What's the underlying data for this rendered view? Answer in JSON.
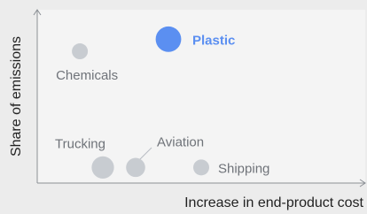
{
  "chart_data": {
    "type": "scatter",
    "xlabel": "Increase in end-product cost",
    "ylabel": "Share of emissions",
    "xlim": [
      0,
      10
    ],
    "ylim": [
      0,
      10
    ],
    "grid": false,
    "colors": {
      "highlight": "#5b8ff1",
      "point": "#c8ccd1",
      "label": "#6f7379",
      "axis": "#8b8f95",
      "background": "#ececec",
      "plot_background": "#f4f4f4"
    },
    "points": [
      {
        "label": "Chemicals",
        "x": 1.3,
        "y": 7.6,
        "size": 1.0,
        "highlight": false
      },
      {
        "label": "Plastic",
        "x": 4.0,
        "y": 8.3,
        "size": 1.6,
        "highlight": true
      },
      {
        "label": "Trucking",
        "x": 2.0,
        "y": 0.9,
        "size": 1.4,
        "highlight": false
      },
      {
        "label": "Aviation",
        "x": 3.0,
        "y": 0.9,
        "size": 1.2,
        "highlight": false
      },
      {
        "label": "Shipping",
        "x": 5.0,
        "y": 0.9,
        "size": 1.0,
        "highlight": false
      }
    ]
  }
}
